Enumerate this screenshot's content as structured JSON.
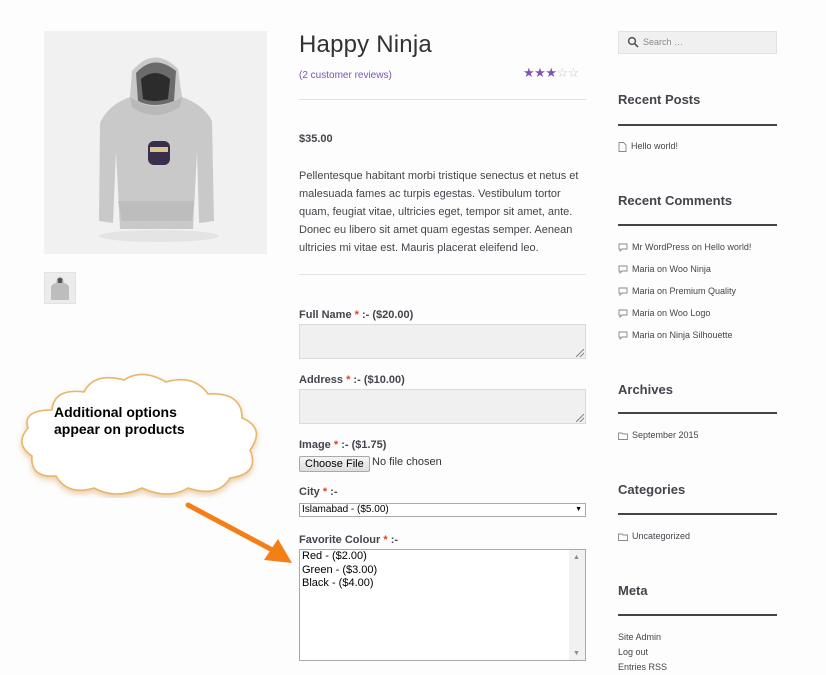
{
  "product": {
    "title": "Happy Ninja",
    "reviews_link": "(2 customer reviews)",
    "rating": 3,
    "rating_max": 5,
    "price": "$35.00",
    "description": "Pellentesque habitant morbi tristique senectus et netus et malesuada fames ac turpis egestas. Vestibulum tortor quam, feugiat vitae, ultricies eget, tempor sit amet, ante. Donec eu libero sit amet quam egestas semper. Aenean ultricies mi vitae est. Mauris placerat eleifend leo."
  },
  "options": {
    "required_mark": "*",
    "full_name": {
      "label": "Full Name",
      "price": " :- ($20.00)"
    },
    "address": {
      "label": "Address",
      "price": " :- ($10.00)"
    },
    "image": {
      "label": "Image",
      "price": " :- ($1.75)",
      "button": "Choose File",
      "status": "No file chosen"
    },
    "city": {
      "label": "City",
      "price": " :-",
      "selected": "Islamabad - ($5.00)"
    },
    "colour": {
      "label": "Favorite Colour",
      "price": " :-",
      "choices": [
        "Red - ($2.00)",
        "Green - ($3.00)",
        "Black - ($4.00)"
      ]
    }
  },
  "sidebar": {
    "search_placeholder": "Search …",
    "recent_posts": {
      "title": "Recent Posts",
      "items": [
        "Hello world!"
      ]
    },
    "recent_comments": {
      "title": "Recent Comments",
      "items": [
        "Mr WordPress on Hello world!",
        "Maria on Woo Ninja",
        "Maria on Premium Quality",
        "Maria on Woo Logo",
        "Maria on Ninja Silhouette"
      ]
    },
    "archives": {
      "title": "Archives",
      "items": [
        "September 2015"
      ]
    },
    "categories": {
      "title": "Categories",
      "items": [
        "Uncategorized"
      ]
    },
    "meta": {
      "title": "Meta",
      "items": [
        "Site Admin",
        "Log out",
        "Entries RSS"
      ]
    }
  },
  "annotation": {
    "line1": "Additional options",
    "line2": "appear on products"
  },
  "colors": {
    "accent": "#7f54b3",
    "required": "#e2401c",
    "callout_arrow": "#f57f17"
  }
}
